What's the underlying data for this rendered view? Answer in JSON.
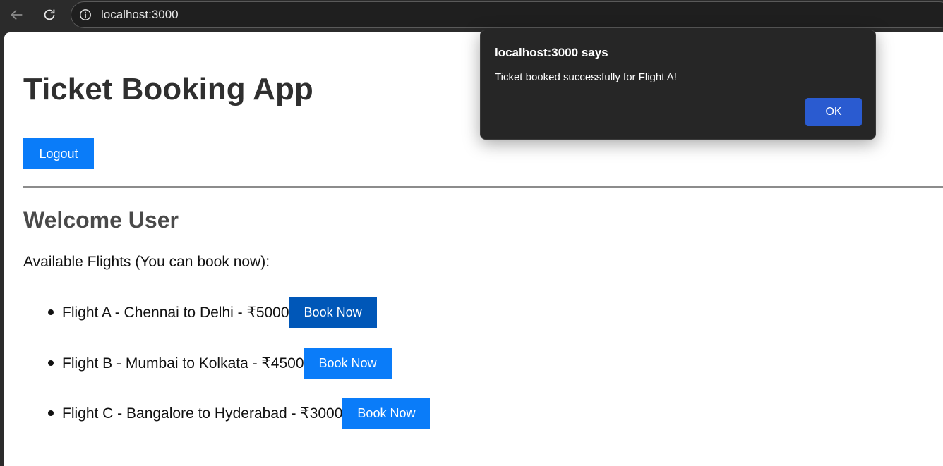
{
  "browser": {
    "url": "localhost:3000",
    "icons": {
      "back": "arrow-left-icon",
      "reload": "reload-icon",
      "info": "info-icon"
    }
  },
  "page": {
    "title": "Ticket Booking App",
    "logout_label": "Logout",
    "welcome": "Welcome User",
    "flights_intro": "Available Flights (You can book now):",
    "flights": [
      {
        "text": "Flight A - Chennai to Delhi - ₹5000",
        "button": "Book Now"
      },
      {
        "text": "Flight B - Mumbai to Kolkata - ₹4500",
        "button": "Book Now"
      },
      {
        "text": "Flight C - Bangalore to Hyderabad - ₹3000",
        "button": "Book Now"
      }
    ],
    "colors": {
      "primary": "#0a7cf9",
      "primary_pressed": "#0057b8"
    }
  },
  "dialog": {
    "title": "localhost:3000 says",
    "message": "Ticket booked successfully for Flight A!",
    "ok_label": "OK",
    "colors": {
      "background": "#262626",
      "ok_button": "#2a5bd0"
    }
  }
}
